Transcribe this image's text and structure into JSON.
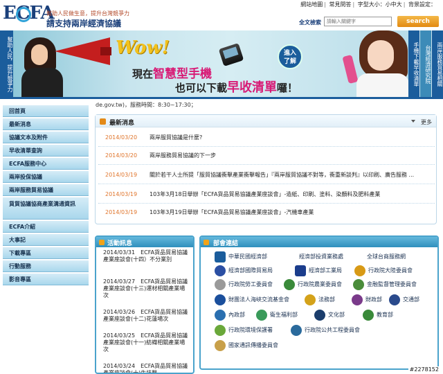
{
  "header": {
    "logo_text": "ECFA",
    "slogan": "幫助人民做生意，提升台灣競爭力",
    "title": "請支持兩岸經濟協議",
    "top_links": [
      "網站地圖",
      "常見問答",
      "字型大小：小中大",
      "背景設定："
    ],
    "search_label": "全文檢索",
    "search_placeholder": "請輸入關鍵字",
    "search_button": "search"
  },
  "banner": {
    "left_tab": "幫助人民，提升競爭力",
    "wow": "Wow!",
    "enter_label_line1": "進入",
    "enter_label_line2": "了解",
    "line1_prefix": "現在",
    "line1_highlight": "智慧型手機",
    "line2_prefix": "也可以下載",
    "line2_highlight": "早收清單",
    "line2_suffix": "囉！",
    "right_tabs": [
      "手機下載早收清單",
      "台灣經濟研究院",
      "兩岸服務貿易相關"
    ]
  },
  "ticker": "de.gov.tw)，服務時間：8:30~17:30；",
  "sidebar": {
    "items": [
      "回首頁",
      "最新消息",
      "協議文本及附件",
      "早收清單查詢",
      "ECFA服務中心",
      "兩岸投保協議",
      "兩岸服務貿易協議",
      "貨貿協議協商產業溝通資訊",
      "ECFA介紹",
      "大事記",
      "下載專區",
      "行動服務",
      "影音專區"
    ]
  },
  "news": {
    "title": "最新消息",
    "more": "更多",
    "items": [
      {
        "date": "2014/03/20",
        "title": "兩岸服貿協議是什麼?"
      },
      {
        "date": "2014/03/20",
        "title": "兩岸服務貿易協議的下一步"
      },
      {
        "date": "2014/03/19",
        "title": "關於若干人士所提「服貿協議衝擊產業衝擊報告」『兩岸服貿協議不對等，衝重新談判』以印刷、廣告服務 ..."
      },
      {
        "date": "2014/03/19",
        "title": "103年3月18日舉辦「ECFA貨品貿易協議產業座談會」-造紙、印刷、塗料、染顏料及肥料產業"
      },
      {
        "date": "2014/03/19",
        "title": "103年3月19日舉辦「ECFA貨品貿易協議產業座談會」-汽機車產業"
      }
    ]
  },
  "activities": {
    "title": "活動訊息",
    "items": [
      "2014/03/31　ECFA貨品貿易協議產業座談會(十四）不分業別",
      "2014/03/27　ECFA貨品貿易協議產業座談會(十三)運材相關產業場次",
      "2014/03/26　ECFA貨品貿易協議產業座談會(十二)花蓮場次",
      "2014/03/25　ECFA貨品貿易協議產業座談會(十一)紡織相關產業場次",
      "2014/03/24　ECFA貨品貿易協議產業座談會(十)生技醫"
    ]
  },
  "links": {
    "title": "部會連結",
    "items": [
      {
        "label": "中華民國經濟部",
        "color": "#1b5d9c"
      },
      {
        "label": "經濟部投資業務處",
        "color": "#ffffff"
      },
      {
        "label": "全球台商服務網",
        "color": "#ffffff"
      },
      {
        "label": "經濟部國際貿易局",
        "color": "#2b4fa3"
      },
      {
        "label": "經濟部工業局",
        "color": "#1b3d8c"
      },
      {
        "label": "行政院大陸委員會",
        "color": "#d89a16"
      },
      {
        "label": "行政院勞工委員會",
        "color": "#9a9a9a"
      },
      {
        "label": "行政院農業委員會",
        "color": "#3a8a3a"
      },
      {
        "label": "金融監督管理委員會",
        "color": "#4a8c3a"
      },
      {
        "label": "財團法人海峽交流基金會",
        "color": "#1b4f9c"
      },
      {
        "label": "法務部",
        "color": "#d4a21a"
      },
      {
        "label": "財政部",
        "color": "#7a3a8a"
      },
      {
        "label": "交通部",
        "color": "#2a4a8c"
      },
      {
        "label": "內政部",
        "color": "#2a6fb0"
      },
      {
        "label": "衛生福利部",
        "color": "#3a9a5a"
      },
      {
        "label": "文化部",
        "color": "#1b3d6c"
      },
      {
        "label": "教育部",
        "color": "#3a8a3a"
      },
      {
        "label": "行政院環境保護署",
        "color": "#6aa83a"
      },
      {
        "label": "行政院公共工程委員會",
        "color": "#2a6a9c"
      },
      {
        "label": "國家通訊傳播委員會",
        "color": "#c8a04a"
      }
    ]
  },
  "watermark": "#2278152"
}
